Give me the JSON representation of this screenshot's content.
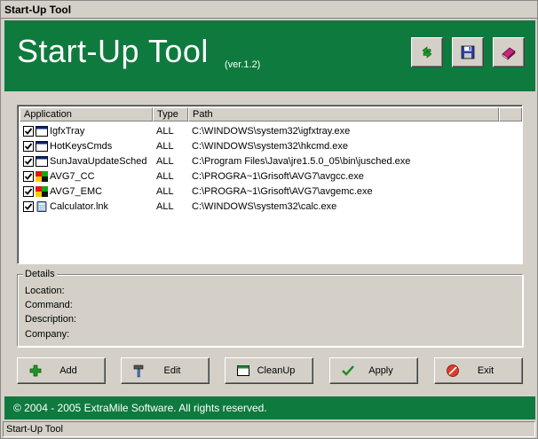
{
  "window": {
    "title": "Start-Up Tool"
  },
  "header": {
    "title": "Start-Up Tool",
    "version": "(ver.1.2)",
    "buttons": [
      {
        "icon": "refresh-icon"
      },
      {
        "icon": "save-icon"
      },
      {
        "icon": "help-book-icon"
      }
    ]
  },
  "list": {
    "columns": [
      "Application",
      "Type",
      "Path"
    ],
    "rows": [
      {
        "name": "IgfxTray",
        "type": "ALL",
        "path": "C:\\WINDOWS\\system32\\igfxtray.exe",
        "checked": true,
        "icon": "window-app-icon"
      },
      {
        "name": "HotKeysCmds",
        "type": "ALL",
        "path": "C:\\WINDOWS\\system32\\hkcmd.exe",
        "checked": true,
        "icon": "window-app-icon"
      },
      {
        "name": "SunJavaUpdateSched",
        "type": "ALL",
        "path": "C:\\Program Files\\Java\\jre1.5.0_05\\bin\\jusched.exe",
        "checked": true,
        "icon": "window-app-icon"
      },
      {
        "name": "AVG7_CC",
        "type": "ALL",
        "path": "C:\\PROGRA~1\\Grisoft\\AVG7\\avgcc.exe",
        "checked": true,
        "icon": "avg-icon"
      },
      {
        "name": "AVG7_EMC",
        "type": "ALL",
        "path": "C:\\PROGRA~1\\Grisoft\\AVG7\\avgemc.exe",
        "checked": true,
        "icon": "avg-icon"
      },
      {
        "name": "Calculator.lnk",
        "type": "ALL",
        "path": "C:\\WINDOWS\\system32\\calc.exe",
        "checked": true,
        "icon": "calculator-icon"
      }
    ]
  },
  "details": {
    "legend": "Details",
    "location_label": "Location:",
    "command_label": "Command:",
    "description_label": "Description:",
    "company_label": "Company:"
  },
  "buttons": {
    "add": "Add",
    "edit": "Edit",
    "cleanup": "CleanUp",
    "apply": "Apply",
    "exit": "Exit"
  },
  "footer": {
    "copyright": "© 2004 - 2005 ExtraMile Software. All rights reserved."
  },
  "status": {
    "text": "Start-Up Tool"
  },
  "colors": {
    "brand_green": "#0f7a3e",
    "face": "#d4d0c8"
  }
}
